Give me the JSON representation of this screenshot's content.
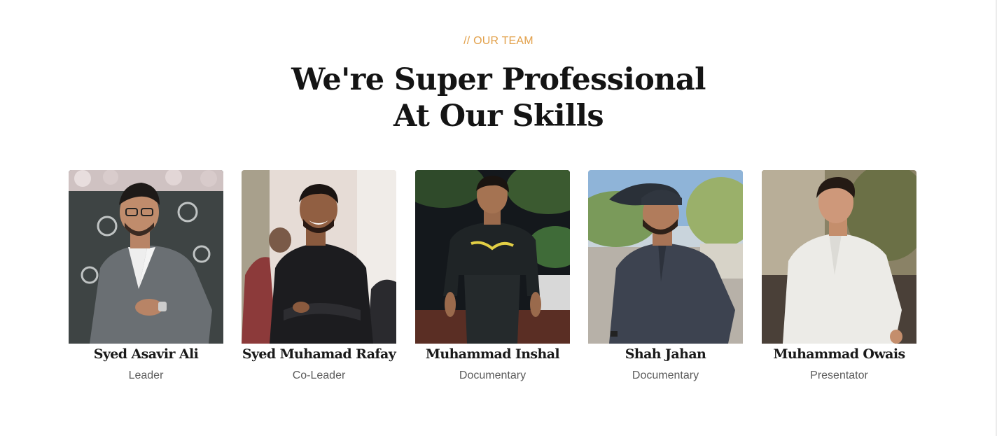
{
  "section": {
    "eyebrow": "// OUR TEAM",
    "title_line1": "We're Super Professional",
    "title_line2": "At Our Skills"
  },
  "members": [
    {
      "name": "Syed Asavir Ali",
      "role": "Leader"
    },
    {
      "name": "Syed Muhamad Rafay",
      "role": "Co-Leader"
    },
    {
      "name": "Muhammad Inshal",
      "role": "Documentary"
    },
    {
      "name": "Shah Jahan",
      "role": "Documentary"
    },
    {
      "name": "Muhammad Owais",
      "role": "Presentator"
    }
  ],
  "colors": {
    "accent": "#e2a04a",
    "heading": "#141414",
    "role_text": "#5b5b5b",
    "background": "#ffffff"
  }
}
